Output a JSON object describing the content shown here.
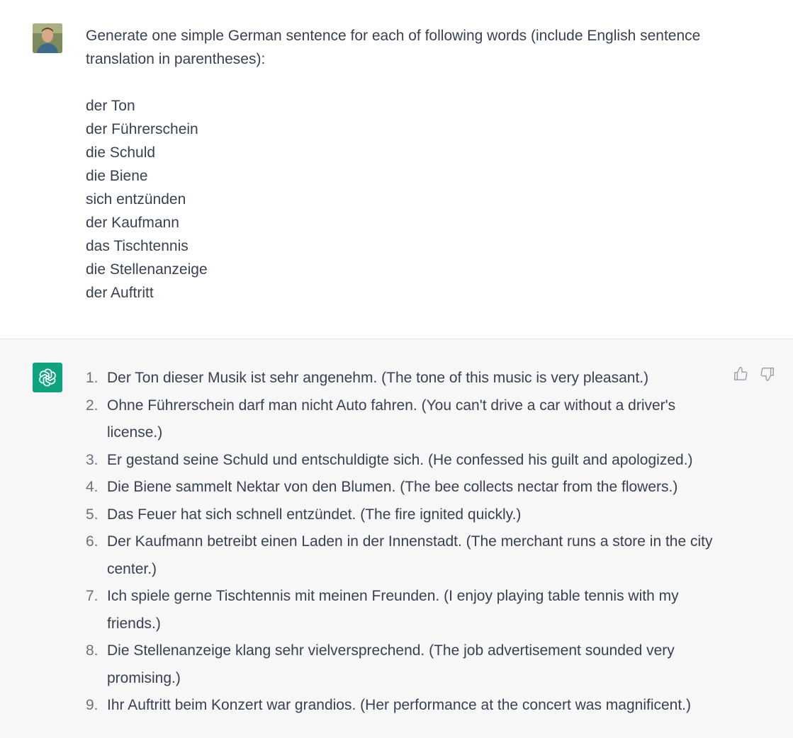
{
  "user_turn": {
    "prompt": "Generate one simple German sentence for each of following words (include English sentence translation in parentheses):",
    "words": [
      "der Ton",
      "der Führerschein",
      "die Schuld",
      "die Biene",
      "sich entzünden",
      "der Kaufmann",
      "das Tischtennis",
      "die Stellenanzeige",
      "der Auftritt"
    ]
  },
  "assistant_turn": {
    "items": [
      {
        "num": "1.",
        "text": "Der Ton dieser Musik ist sehr angenehm. (The tone of this music is very pleasant.)"
      },
      {
        "num": "2.",
        "text": "Ohne Führerschein darf man nicht Auto fahren. (You can't drive a car without a driver's license.)"
      },
      {
        "num": "3.",
        "text": "Er gestand seine Schuld und entschuldigte sich. (He confessed his guilt and apologized.)"
      },
      {
        "num": "4.",
        "text": "Die Biene sammelt Nektar von den Blumen. (The bee collects nectar from the flowers.)"
      },
      {
        "num": "5.",
        "text": "Das Feuer hat sich schnell entzündet. (The fire ignited quickly.)"
      },
      {
        "num": "6.",
        "text": "Der Kaufmann betreibt einen Laden in der Innenstadt. (The merchant runs a store in the city center.)"
      },
      {
        "num": "7.",
        "text": "Ich spiele gerne Tischtennis mit meinen Freunden. (I enjoy playing table tennis with my friends.)"
      },
      {
        "num": "8.",
        "text": "Die Stellenanzeige klang sehr vielversprechend. (The job advertisement sounded very promising.)"
      },
      {
        "num": "9.",
        "text": "Ihr Auftritt beim Konzert war grandios. (Her performance at the concert was magnificent.)"
      }
    ],
    "feedback_icons": [
      "thumbs-up-icon",
      "thumbs-down-icon"
    ]
  },
  "colors": {
    "assistant_bg": "#f7f7f8",
    "assistant_avatar": "#10a37f",
    "text": "#374151"
  }
}
